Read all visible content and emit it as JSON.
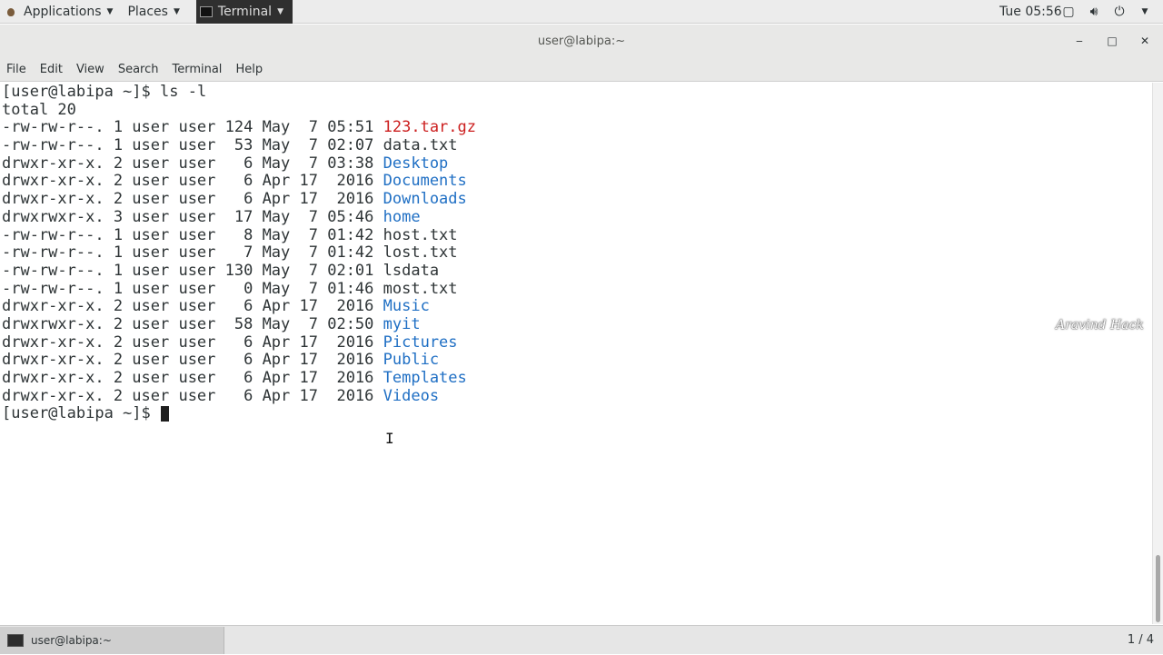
{
  "top_panel": {
    "applications_label": "Applications",
    "places_label": "Places",
    "terminal_app_label": "Terminal",
    "clock": "Tue 05:56",
    "icons": [
      "window-icon",
      "volume-icon",
      "power-icon"
    ]
  },
  "window": {
    "title": "user@labipa:~",
    "controls": {
      "minimize": "‒",
      "maximize": "□",
      "close": "✕"
    }
  },
  "menubar": {
    "items": [
      "File",
      "Edit",
      "View",
      "Search",
      "Terminal",
      "Help"
    ]
  },
  "terminal": {
    "prompt": "[user@labipa ~]$ ",
    "command": "ls -l",
    "total": "total 20",
    "colors": {
      "directory": "#1f6fc4",
      "archive": "#cc1f1f",
      "default": "#2e3436"
    },
    "entries": [
      {
        "meta": "-rw-rw-r--. 1 user user 124 May  7 05:51 ",
        "name": "123.tar.gz",
        "kind": "archive"
      },
      {
        "meta": "-rw-rw-r--. 1 user user  53 May  7 02:07 ",
        "name": "data.txt",
        "kind": "file"
      },
      {
        "meta": "drwxr-xr-x. 2 user user   6 May  7 03:38 ",
        "name": "Desktop",
        "kind": "dir"
      },
      {
        "meta": "drwxr-xr-x. 2 user user   6 Apr 17  2016 ",
        "name": "Documents",
        "kind": "dir"
      },
      {
        "meta": "drwxr-xr-x. 2 user user   6 Apr 17  2016 ",
        "name": "Downloads",
        "kind": "dir"
      },
      {
        "meta": "drwxrwxr-x. 3 user user  17 May  7 05:46 ",
        "name": "home",
        "kind": "dir"
      },
      {
        "meta": "-rw-rw-r--. 1 user user   8 May  7 01:42 ",
        "name": "host.txt",
        "kind": "file"
      },
      {
        "meta": "-rw-rw-r--. 1 user user   7 May  7 01:42 ",
        "name": "lost.txt",
        "kind": "file"
      },
      {
        "meta": "-rw-rw-r--. 1 user user 130 May  7 02:01 ",
        "name": "lsdata",
        "kind": "file"
      },
      {
        "meta": "-rw-rw-r--. 1 user user   0 May  7 01:46 ",
        "name": "most.txt",
        "kind": "file"
      },
      {
        "meta": "drwxr-xr-x. 2 user user   6 Apr 17  2016 ",
        "name": "Music",
        "kind": "dir"
      },
      {
        "meta": "drwxrwxr-x. 2 user user  58 May  7 02:50 ",
        "name": "myit",
        "kind": "dir"
      },
      {
        "meta": "drwxr-xr-x. 2 user user   6 Apr 17  2016 ",
        "name": "Pictures",
        "kind": "dir"
      },
      {
        "meta": "drwxr-xr-x. 2 user user   6 Apr 17  2016 ",
        "name": "Public",
        "kind": "dir"
      },
      {
        "meta": "drwxr-xr-x. 2 user user   6 Apr 17  2016 ",
        "name": "Templates",
        "kind": "dir"
      },
      {
        "meta": "drwxr-xr-x. 2 user user   6 Apr 17  2016 ",
        "name": "Videos",
        "kind": "dir"
      }
    ],
    "final_prompt": "[user@labipa ~]$ "
  },
  "watermark": "Aravind Hack",
  "bottom_panel": {
    "task_label": "user@labipa:~",
    "workspace": "1 / 4"
  }
}
